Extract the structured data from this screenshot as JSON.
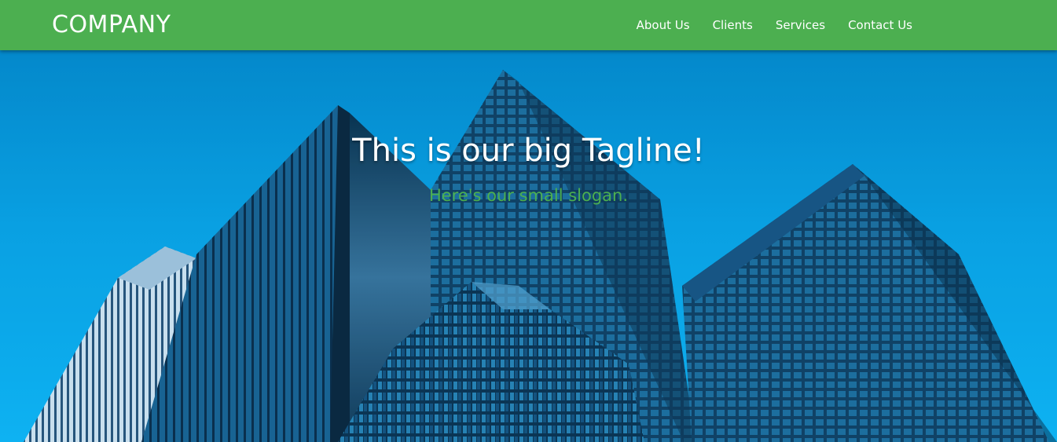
{
  "header": {
    "brand": "COMPANY",
    "nav": [
      {
        "label": "About Us"
      },
      {
        "label": "Clients"
      },
      {
        "label": "Services"
      },
      {
        "label": "Contact Us"
      }
    ]
  },
  "hero": {
    "tagline": "This is our big Tagline!",
    "slogan": "Here's our small slogan."
  },
  "colors": {
    "primary_green": "#4caf50",
    "sky_blue": "#0aa0e2",
    "white": "#ffffff"
  }
}
